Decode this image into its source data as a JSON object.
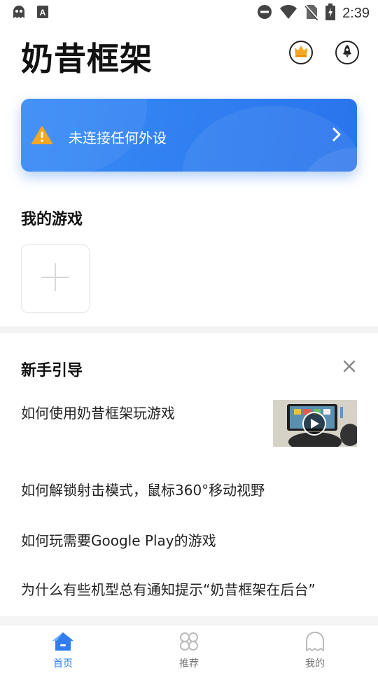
{
  "status_bar": {
    "time": "2:39",
    "icons": [
      "ghost-icon",
      "keyboard-a-icon",
      "do-not-disturb-icon",
      "wifi-icon",
      "no-sim-icon",
      "battery-charging-icon"
    ]
  },
  "header": {
    "title": "奶昔框架",
    "crown_icon": "crown-icon",
    "rocket_icon": "rocket-icon"
  },
  "banner": {
    "text": "未连接任何外设",
    "warning_color": "#f5a623",
    "accent": "#2f7df0"
  },
  "my_games": {
    "title": "我的游戏"
  },
  "guide": {
    "title": "新手引导",
    "items": [
      "如何使用奶昔框架玩游戏",
      "如何解锁射击模式，鼠标360°移动视野",
      "如何玩需要Google Play的游戏",
      "为什么有些机型总有通知提示“奶昔框架在后台”"
    ]
  },
  "tabbar": {
    "tabs": [
      {
        "label": "首页",
        "icon": "home-icon",
        "active": true
      },
      {
        "label": "推荐",
        "icon": "clover-icon",
        "active": false
      },
      {
        "label": "我的",
        "icon": "ghost-profile-icon",
        "active": false
      }
    ]
  }
}
